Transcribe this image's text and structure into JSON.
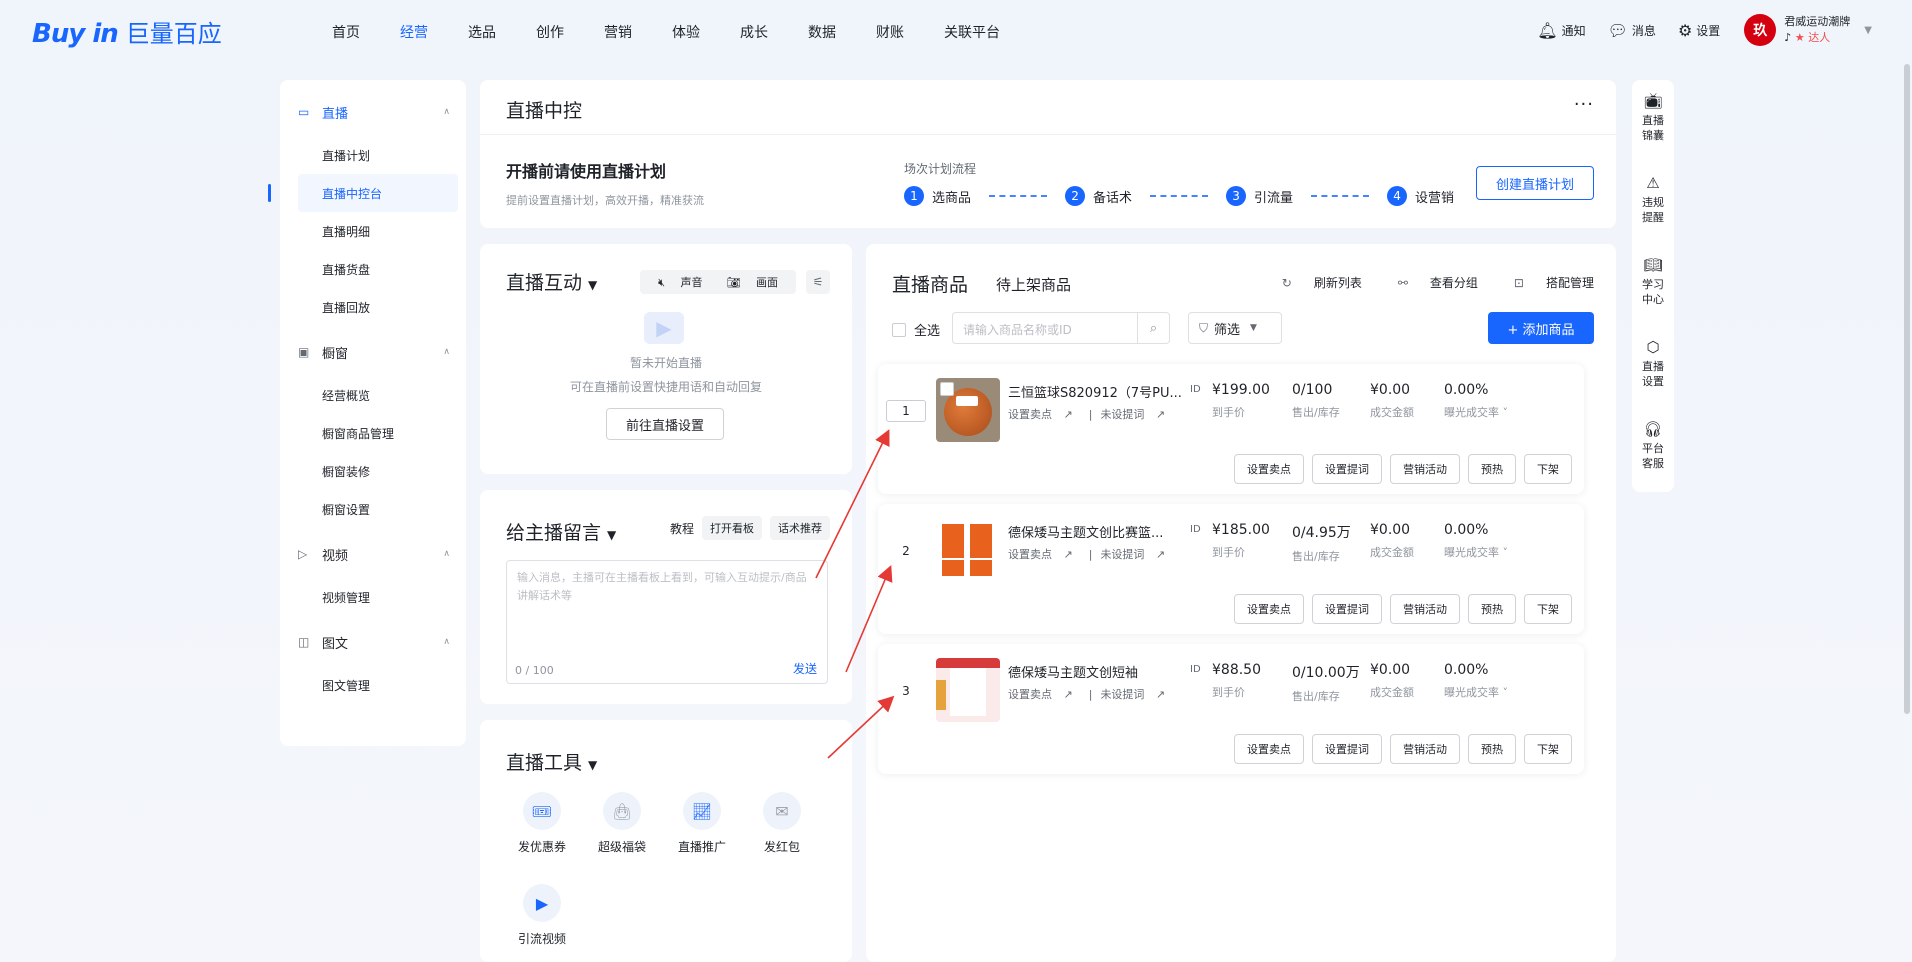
{
  "logo": {
    "en": "Buy in",
    "cn": "巨量百应"
  },
  "nav": [
    "首页",
    "经营",
    "选品",
    "创作",
    "营销",
    "体验",
    "成长",
    "数据",
    "财账",
    "关联平台"
  ],
  "nav_active": 1,
  "topright": {
    "notify": "通知",
    "message": "消息",
    "settings": "设置",
    "avatar_text": "玖",
    "account_name": "君威运动潮牌",
    "account_tag": "达人"
  },
  "sidebar": [
    {
      "title": "直播",
      "icon": "live-icon",
      "active": true,
      "items": [
        "直播计划",
        "直播中控台",
        "直播明细",
        "直播货盘",
        "直播回放"
      ],
      "active_item": 1
    },
    {
      "title": "橱窗",
      "icon": "window-icon",
      "items": [
        "经营概览",
        "橱窗商品管理",
        "橱窗装修",
        "橱窗设置"
      ]
    },
    {
      "title": "视频",
      "icon": "video-icon",
      "items": [
        "视频管理"
      ]
    },
    {
      "title": "图文",
      "icon": "image-text-icon",
      "items": [
        "图文管理"
      ]
    }
  ],
  "header": {
    "title": "直播中控",
    "more": "···",
    "plan_title": "开播前请使用直播计划",
    "plan_sub": "提前设置直播计划，高效开播，精准获流",
    "flow_label": "场次计划流程",
    "steps": [
      {
        "n": "1",
        "label": "选商品"
      },
      {
        "n": "2",
        "label": "备话术"
      },
      {
        "n": "3",
        "label": "引流量"
      },
      {
        "n": "4",
        "label": "设营销"
      }
    ],
    "create_btn": "创建直播计划"
  },
  "interact": {
    "title": "直播互动",
    "sound": "声音",
    "picture": "画面",
    "empty_title": "暂未开始直播",
    "empty_sub": "可在直播前设置快捷用语和自动回复",
    "go_btn": "前往直播设置"
  },
  "message": {
    "title": "给主播留言",
    "tutorial": "教程",
    "open_board": "打开看板",
    "recommend": "话术推荐",
    "placeholder": "输入消息，主播可在主播看板上看到，可输入互动提示/商品讲解话术等",
    "count": "0 / 100",
    "send": "发送"
  },
  "tools": {
    "title": "直播工具",
    "items": [
      {
        "label": "发优惠券",
        "icon": "coupon-icon"
      },
      {
        "label": "超级福袋",
        "icon": "lucky-bag-icon"
      },
      {
        "label": "直播推广",
        "icon": "promotion-icon"
      },
      {
        "label": "发红包",
        "icon": "red-packet-icon"
      },
      {
        "label": "引流视频",
        "icon": "play-video-icon"
      }
    ]
  },
  "goods": {
    "tab_active": "直播商品",
    "tab_other": "待上架商品",
    "refresh": "刷新列表",
    "view_group": "查看分组",
    "match_manage": "搭配管理",
    "select_all": "全选",
    "search_placeholder": "请输入商品名称或ID",
    "filter": "筛选",
    "add_btn": "+ 添加商品",
    "col_labels": {
      "price": "到手价",
      "stock": "售出/库存",
      "amount": "成交金额",
      "rate": "曝光成交率"
    },
    "links": {
      "point": "设置卖点",
      "prompt": "未设提词"
    },
    "buttons": [
      "设置卖点",
      "设置提词",
      "营销活动",
      "预热",
      "下架"
    ],
    "products": [
      {
        "index": "1",
        "name": "三恒篮球S820912（7号PU...",
        "id": "ID",
        "price": "¥199.00",
        "stock": "0/100",
        "amount": "¥0.00",
        "rate": "0.00%"
      },
      {
        "index": "2",
        "name": "德保矮马主题文创比赛篮...",
        "id": "ID",
        "price": "¥185.00",
        "stock": "0/4.95万",
        "amount": "¥0.00",
        "rate": "0.00%"
      },
      {
        "index": "3",
        "name": "德保矮马主题文创短袖",
        "id": "ID",
        "price": "¥88.50",
        "stock": "0/10.00万",
        "amount": "¥0.00",
        "rate": "0.00%"
      }
    ]
  },
  "rightbar": [
    {
      "label": "直播\n锦囊",
      "icon": "tv-icon"
    },
    {
      "label": "违规\n提醒",
      "icon": "warning-icon"
    },
    {
      "label": "学习\n中心",
      "icon": "book-icon"
    },
    {
      "label": "直播\n设置",
      "icon": "settings-hex-icon"
    },
    {
      "label": "平台\n客服",
      "icon": "headset-icon"
    }
  ]
}
